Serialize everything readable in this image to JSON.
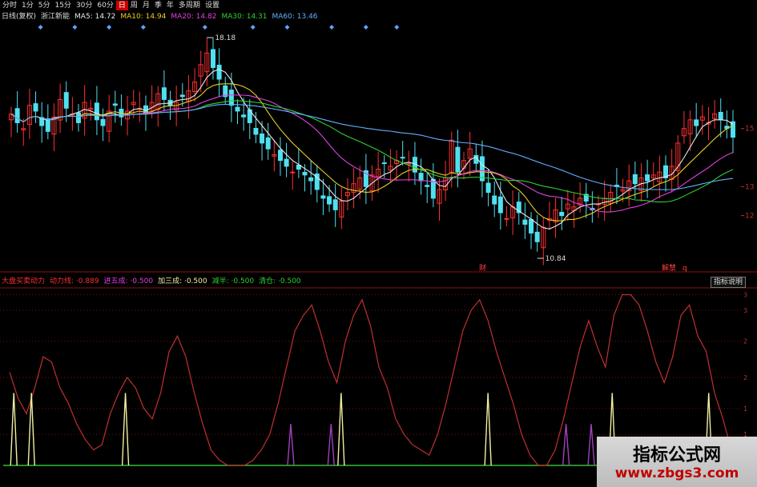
{
  "toolbar": {
    "items": [
      {
        "label": "分时",
        "active": false
      },
      {
        "label": "1分",
        "active": false
      },
      {
        "label": "5分",
        "active": false
      },
      {
        "label": "15分",
        "active": false
      },
      {
        "label": "30分",
        "active": false
      },
      {
        "label": "60分",
        "active": false
      },
      {
        "label": "日",
        "active": true
      },
      {
        "label": "周",
        "active": false
      },
      {
        "label": "月",
        "active": false
      },
      {
        "label": "季",
        "active": false
      },
      {
        "label": "年",
        "active": false
      },
      {
        "label": "多周期",
        "active": false
      },
      {
        "label": "设置",
        "active": false
      }
    ]
  },
  "price_panel": {
    "header": [
      {
        "text": "日线(复权)",
        "color": "#dddddd"
      },
      {
        "text": "浙江新能",
        "color": "#dddddd"
      },
      {
        "text": "MA5: 14.72",
        "color": "#e8e8e8"
      },
      {
        "text": "MA10: 14.94",
        "color": "#e8d020"
      },
      {
        "text": "MA20: 14.82",
        "color": "#e040e0"
      },
      {
        "text": "MA30: 14.31",
        "color": "#30d030"
      },
      {
        "text": "MA60: 13.46",
        "color": "#60b0ff"
      }
    ],
    "high_label": "18.18",
    "low_label": "10.84",
    "event_markers": [
      "财",
      "解禁",
      "q"
    ],
    "y_labels": [
      "15",
      "13",
      "12"
    ]
  },
  "indicator_panel": {
    "header": [
      {
        "text": "大盘买卖动力",
        "color": "#ff3030"
      },
      {
        "text": "动力线: ·0.889",
        "color": "#ff3030"
      },
      {
        "text": "进五成: ·0.500",
        "color": "#e040e0"
      },
      {
        "text": "加三成: ·0.500",
        "color": "#f0f0a0"
      },
      {
        "text": "减半: ·0.500",
        "color": "#30d030"
      },
      {
        "text": "清仓: ·0.500",
        "color": "#30d030"
      }
    ],
    "button": "指标说明",
    "y_labels": [
      "3",
      "3",
      "2",
      "2",
      "1",
      "1"
    ]
  },
  "watermark": {
    "title": "指标公式网",
    "url": "www.zbgs3.com"
  },
  "colors": {
    "up": "#ff3030",
    "down": "#50e0f0",
    "ma5": "#e8e8e8",
    "ma10": "#e8d020",
    "ma20": "#e040e0",
    "ma30": "#30d030",
    "ma60": "#60b0ff",
    "dyn_line": "#c03030",
    "jia": "#f0f0a0",
    "jin": "#a040c0",
    "zero": "#30c030",
    "diamond": "#60a0ff"
  },
  "chart_data": [
    {
      "type": "candlestick",
      "title": "日线(复权) 浙江新能",
      "ylim": [
        10.2,
        18.6
      ],
      "y_ticks": [
        15,
        13,
        12
      ],
      "high": 18.18,
      "low": 10.84,
      "close_series": [
        15.5,
        15.2,
        15.0,
        15.8,
        15.6,
        15.1,
        14.9,
        15.4,
        16.0,
        15.7,
        15.5,
        15.2,
        15.9,
        15.7,
        15.3,
        15.1,
        15.6,
        15.8,
        15.4,
        15.6,
        15.9,
        15.7,
        15.5,
        15.9,
        16.2,
        16.0,
        15.8,
        15.9,
        16.1,
        16.3,
        16.6,
        17.2,
        17.6,
        17.1,
        16.7,
        16.1,
        15.8,
        15.6,
        15.4,
        15.2,
        14.8,
        14.5,
        14.3,
        14.1,
        13.9,
        13.7,
        13.5,
        13.6,
        13.4,
        13.2,
        12.9,
        12.6,
        12.4,
        12.2,
        12.5,
        12.8,
        13.1,
        13.3,
        13.0,
        13.4,
        13.6,
        13.8,
        13.7,
        13.9,
        14.0,
        13.8,
        13.5,
        13.2,
        13.0,
        12.6,
        12.9,
        13.3,
        14.6,
        13.5,
        13.9,
        14.3,
        13.8,
        13.2,
        12.8,
        12.4,
        12.1,
        11.9,
        12.3,
        12.1,
        11.7,
        11.4,
        11.1,
        11.6,
        11.9,
        12.2,
        12.0,
        12.4,
        12.3,
        12.6,
        12.5,
        12.2,
        12.4,
        12.6,
        12.8,
        13.0,
        12.9,
        13.2,
        13.1,
        13.3,
        13.2,
        13.4,
        13.5,
        13.3,
        13.7,
        14.5,
        15.0,
        15.3,
        15.1,
        15.4,
        15.2,
        15.5,
        15.3,
        15.0,
        14.7
      ],
      "ma_series": [
        {
          "name": "MA5",
          "value": 14.72
        },
        {
          "name": "MA10",
          "value": 14.94
        },
        {
          "name": "MA20",
          "value": 14.82
        },
        {
          "name": "MA30",
          "value": 14.31
        },
        {
          "name": "MA60",
          "value": 13.46
        }
      ]
    },
    {
      "type": "line",
      "title": "大盘买卖动力",
      "ylim": [
        0,
        3.4
      ],
      "series": [
        {
          "name": "动力线",
          "values": [
            1.8,
            1.3,
            1.0,
            1.5,
            2.1,
            2.0,
            1.5,
            1.2,
            0.8,
            0.5,
            0.3,
            0.4,
            1.0,
            1.4,
            1.7,
            1.5,
            1.1,
            0.9,
            1.4,
            2.2,
            2.5,
            2.1,
            1.4,
            0.8,
            0.3,
            0.1,
            0.0,
            0.0,
            0.0,
            0.1,
            0.3,
            0.6,
            1.2,
            1.9,
            2.6,
            2.9,
            3.1,
            2.6,
            2.0,
            1.6,
            2.4,
            2.9,
            3.2,
            2.7,
            1.9,
            1.5,
            0.9,
            0.6,
            0.4,
            0.3,
            0.2,
            0.6,
            1.2,
            1.9,
            2.6,
            3.0,
            3.2,
            2.8,
            2.2,
            1.7,
            1.2,
            0.6,
            0.2,
            0.0,
            0.0,
            0.3,
            0.9,
            1.6,
            2.3,
            2.8,
            2.3,
            1.9,
            2.9,
            3.3,
            3.3,
            3.1,
            2.6,
            2.0,
            1.6,
            2.1,
            2.9,
            3.1,
            2.5,
            2.2,
            1.4,
            0.9,
            0.3
          ]
        },
        {
          "name": "加三成",
          "spikes": [
            0.5,
            2.6,
            13.8,
            39.5,
            57.0,
            71.8,
            83.3,
            97.3,
            110.0
          ]
        },
        {
          "name": "进五成",
          "spikes": [
            33.5,
            38.3,
            66.3,
            69.3
          ]
        },
        {
          "name": "减半",
          "values": []
        },
        {
          "name": "清仓",
          "values": []
        }
      ]
    }
  ]
}
